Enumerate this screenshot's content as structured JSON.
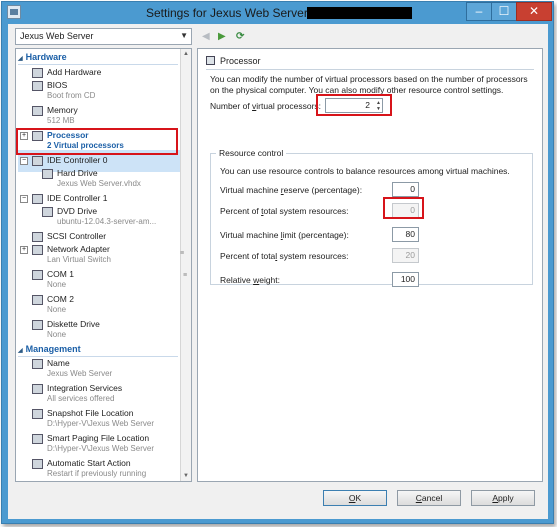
{
  "window": {
    "title": "Settings for Jexus Web Server on",
    "buttons": {
      "minimize": "–",
      "maximize": "☐",
      "close": "✕"
    }
  },
  "vm_selector": {
    "value": "Jexus Web Server"
  },
  "sidebar": {
    "hardware_label": "Hardware",
    "management_label": "Management",
    "hardware_items": [
      {
        "label": "Add Hardware",
        "sub": "",
        "icon": "add-hardware-icon"
      },
      {
        "label": "BIOS",
        "sub": "Boot from CD",
        "icon": "bios-icon"
      },
      {
        "label": "Memory",
        "sub": "512 MB",
        "icon": "memory-icon"
      },
      {
        "label": "Processor",
        "sub": "2 Virtual processors",
        "icon": "processor-icon",
        "selected": true
      },
      {
        "label": "IDE Controller 0",
        "sub": "",
        "icon": "ide-controller-icon"
      },
      {
        "label": "Hard Drive",
        "sub": "Jexus Web Server.vhdx",
        "icon": "hard-drive-icon"
      },
      {
        "label": "IDE Controller 1",
        "sub": "",
        "icon": "ide-controller-icon"
      },
      {
        "label": "DVD Drive",
        "sub": "ubuntu-12.04.3-server-am...",
        "icon": "dvd-drive-icon"
      },
      {
        "label": "SCSI Controller",
        "sub": "",
        "icon": "scsi-controller-icon"
      },
      {
        "label": "Network Adapter",
        "sub": "Lan Virtual Switch",
        "icon": "network-adapter-icon"
      },
      {
        "label": "COM 1",
        "sub": "None",
        "icon": "com-port-icon"
      },
      {
        "label": "COM 2",
        "sub": "None",
        "icon": "com-port-icon"
      },
      {
        "label": "Diskette Drive",
        "sub": "None",
        "icon": "diskette-icon"
      }
    ],
    "management_items": [
      {
        "label": "Name",
        "sub": "Jexus Web Server",
        "icon": "name-icon"
      },
      {
        "label": "Integration Services",
        "sub": "All services offered",
        "icon": "integration-services-icon"
      },
      {
        "label": "Snapshot File Location",
        "sub": "D:\\Hyper-V\\Jexus Web Server",
        "icon": "snapshot-location-icon"
      },
      {
        "label": "Smart Paging File Location",
        "sub": "D:\\Hyper-V\\Jexus Web Server",
        "icon": "smart-paging-icon"
      },
      {
        "label": "Automatic Start Action",
        "sub": "Restart if previously running",
        "icon": "auto-start-icon"
      }
    ]
  },
  "nav": {
    "back": "◀",
    "forward": "▶",
    "refresh": "⟳"
  },
  "processor": {
    "title": "Processor",
    "description": "You can modify the number of virtual processors based on the number of processors on the physical computer. You can also modify other resource control settings.",
    "vp_label_pre": "Number of ",
    "vp_label_u": "v",
    "vp_label_post": "irtual processors:",
    "vp_value": "2",
    "resource_control": {
      "legend": "Resource control",
      "description": "You can use resource controls to balance resources among virtual machines.",
      "fields": [
        {
          "pre": "Virtual machine ",
          "u": "r",
          "post": "eserve (percentage):",
          "value": "0",
          "disabled": false
        },
        {
          "pre": "Percent of ",
          "u": "t",
          "post": "otal system resources:",
          "value": "0",
          "disabled": true
        },
        {
          "pre": "Virtual machine ",
          "u": "l",
          "post": "imit (percentage):",
          "value": "80",
          "disabled": false
        },
        {
          "pre": "Percent of tota",
          "u": "l",
          "post": " system resources:",
          "value": "20",
          "disabled": true
        },
        {
          "pre": "Relative ",
          "u": "w",
          "post": "eight:",
          "value": "100",
          "disabled": false
        }
      ]
    }
  },
  "buttons": {
    "ok": "OK",
    "ok_u": "O",
    "ok_rest": "K",
    "cancel_u": "C",
    "cancel_rest": "ancel",
    "apply_u": "A",
    "apply_rest": "pply"
  }
}
